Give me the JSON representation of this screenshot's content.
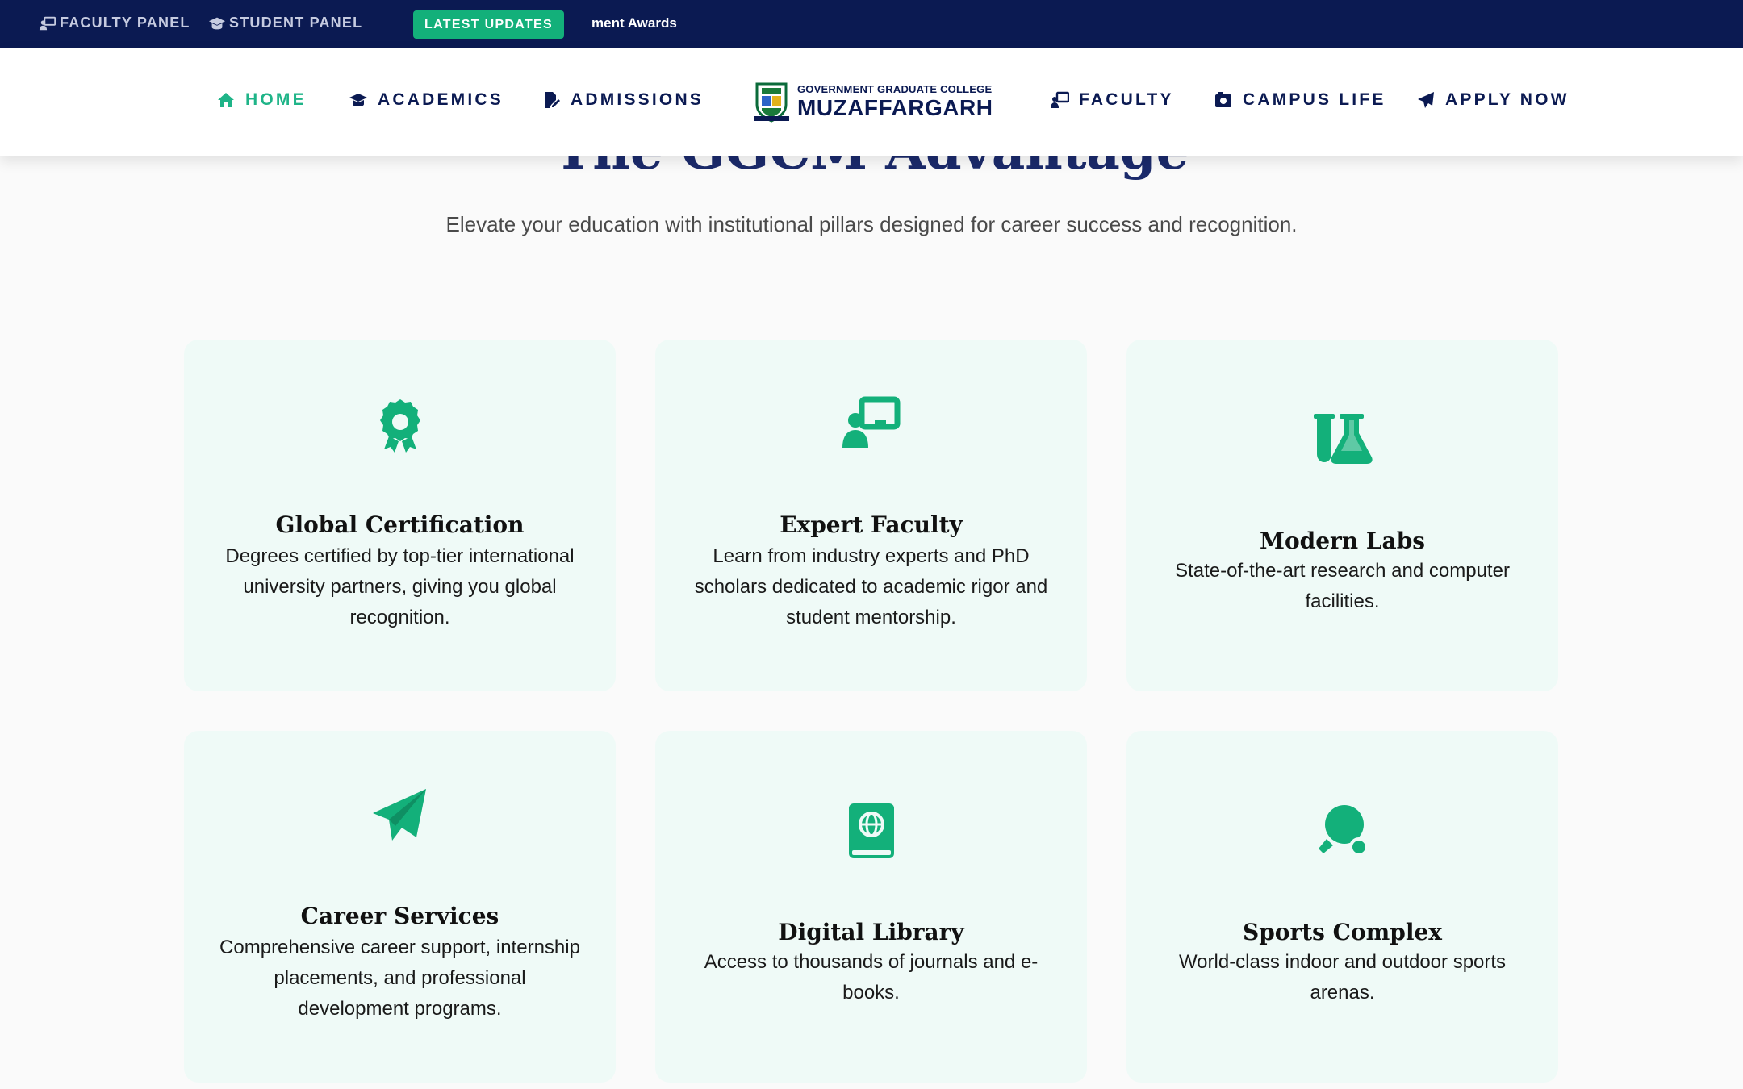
{
  "topbar": {
    "faculty_panel": "FACULTY PANEL",
    "student_panel": "STUDENT PANEL",
    "badge": "LATEST UPDATES",
    "ticker": "ment Awards"
  },
  "nav": {
    "home": "HOME",
    "academics": "ACADEMICS",
    "admissions": "ADMISSIONS",
    "faculty": "FACULTY",
    "campus_life": "CAMPUS LIFE",
    "apply_now": "APPLY NOW",
    "logo_small": "GOVERNMENT GRADUATE COLLEGE",
    "logo_big": "MUZAFFARGARH"
  },
  "section": {
    "heading": "The GGCM Advantage",
    "subtitle": "Elevate your education with institutional pillars designed for career success and recognition."
  },
  "cards": [
    {
      "icon": "award-icon",
      "title": "Global Certification",
      "desc": "Degrees certified by top-tier international university partners, giving you global recognition."
    },
    {
      "icon": "chalkboard-teacher-icon",
      "title": "Expert Faculty",
      "desc": "Learn from industry experts and PhD scholars dedicated to academic rigor and student mentorship."
    },
    {
      "icon": "flask-icon",
      "title": "Modern Labs",
      "desc": "State-of-the-art research and computer facilities."
    },
    {
      "icon": "paper-plane-icon",
      "title": "Career Services",
      "desc": "Comprehensive career support, internship placements, and professional development programs."
    },
    {
      "icon": "atlas-book-icon",
      "title": "Digital Library",
      "desc": "Access to thousands of journals and e-books."
    },
    {
      "icon": "table-tennis-icon",
      "title": "Sports Complex",
      "desc": "World-class indoor and outdoor sports arenas."
    }
  ],
  "colors": {
    "navy": "#0b1a52",
    "accent": "#13b07a",
    "card_bg": "#effaf7"
  }
}
